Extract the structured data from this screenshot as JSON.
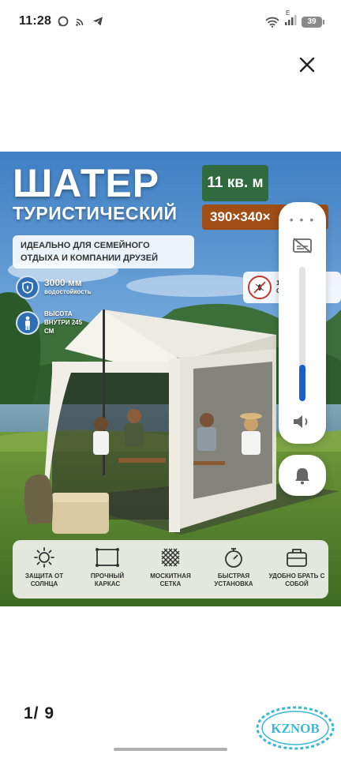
{
  "status_bar": {
    "time": "11:28",
    "network_label": "E",
    "battery": "39"
  },
  "product_image": {
    "title": "ШАТЕР",
    "subtitle": "ТУРИСТИЧЕСКИЙ",
    "area_badge": "11 кв. м",
    "size_badge": "390×340×",
    "tagline": "ИДЕАЛЬНО ДЛЯ СЕМЕЙНОГО ОТДЫХА И КОМПАНИИ ДРУЗЕЙ",
    "waterproof_value": "3000 мм",
    "waterproof_label": "водостойкость",
    "height_label": "ВЫСОТА ВНУТРИ 245 СМ",
    "mosquito_label_1": "1 А",
    "mosquito_label_2": "С Х",
    "features": [
      {
        "label": "ЗАЩИТА ОТ СОЛНЦА",
        "icon": "sun-icon"
      },
      {
        "label": "ПРОЧНЫЙ КАРКАС",
        "icon": "frame-icon"
      },
      {
        "label": "МОСКИТНАЯ СЕТКА",
        "icon": "mesh-icon"
      },
      {
        "label": "БЫСТРАЯ УСТАНОВКА",
        "icon": "stopwatch-icon"
      },
      {
        "label": "УДОБНО БРАТЬ С СОБОЙ",
        "icon": "bag-icon"
      }
    ]
  },
  "volume_panel": {
    "level_fraction": 0.27
  },
  "gallery": {
    "page_indicator": "1/ 9"
  },
  "watermark": {
    "text": "KZNOB"
  },
  "colors": {
    "accent_blue": "#1a5fd0",
    "badge_green": "#2f6b3e",
    "badge_orange": "#a04d16"
  }
}
